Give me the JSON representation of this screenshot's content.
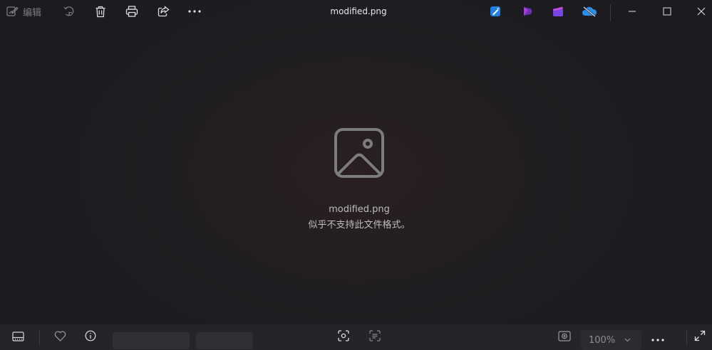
{
  "toolbar": {
    "edit_label": "编辑",
    "icons": [
      "edit-icon",
      "rotate-icon",
      "delete-icon",
      "print-icon",
      "share-icon",
      "more-icon"
    ]
  },
  "window": {
    "title": "modified.png",
    "controls": [
      "minimize-icon",
      "maximize-icon",
      "close-icon"
    ]
  },
  "apps": [
    "designer-icon",
    "clipchamp-icon",
    "video-editor-icon",
    "onedrive-icon"
  ],
  "content": {
    "filename": "modified.png",
    "message": "似乎不支持此文件格式。",
    "icon": "image-placeholder-icon"
  },
  "bottombar": {
    "zoom": "100%",
    "icons": [
      "filmstrip-icon",
      "heart-icon",
      "info-icon",
      "visual-search-icon",
      "ocr-icon",
      "preview-icon",
      "more-icon",
      "fullscreen-icon"
    ]
  },
  "colors": {
    "background": "#1f1d21",
    "bottombar": "#252428",
    "accent_onedrive": "#2b8fe6"
  }
}
